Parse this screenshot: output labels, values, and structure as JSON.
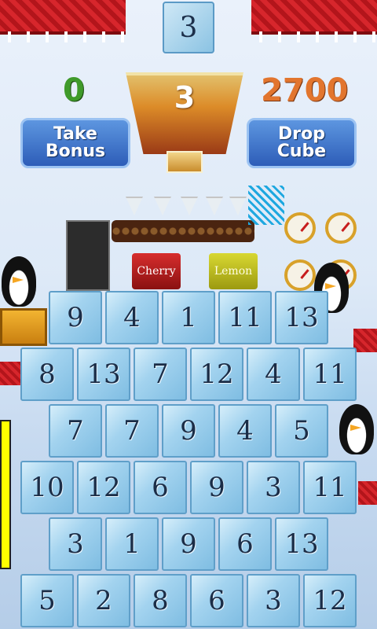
{
  "top": {
    "drop_counter": "3"
  },
  "scores": {
    "left": "0",
    "glass": "3",
    "right": "2700"
  },
  "buttons": {
    "take_bonus": "Take\nBonus",
    "drop_cube": "Drop\nCube"
  },
  "machine": {
    "can_cherry": "Cherry",
    "can_lemon": "Lemon"
  },
  "grid": {
    "rows": [
      [
        "9",
        "4",
        "1",
        "11",
        "13"
      ],
      [
        "8",
        "13",
        "7",
        "12",
        "4",
        "11"
      ],
      [
        "7",
        "7",
        "9",
        "4",
        "5"
      ],
      [
        "10",
        "12",
        "6",
        "9",
        "3",
        "11"
      ],
      [
        "3",
        "1",
        "9",
        "6",
        "13"
      ],
      [
        "5",
        "2",
        "8",
        "6",
        "3",
        "12"
      ]
    ]
  },
  "colors": {
    "score_left": "#3f9a2a",
    "score_right": "#e2752e",
    "button": "#2d5db8",
    "cube": "#a3d3ef"
  },
  "icons": [
    "penguin-icon",
    "gauge-icon",
    "spring-icon"
  ]
}
